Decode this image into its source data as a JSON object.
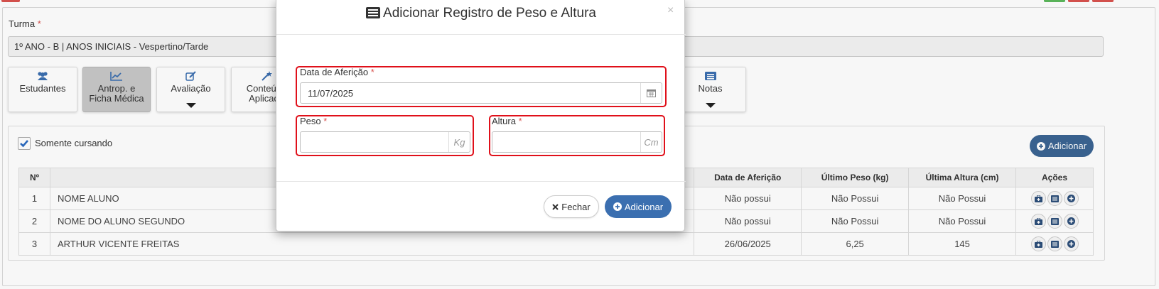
{
  "colors": {
    "accent": "#3b6fb0",
    "header_add": "#3b6593",
    "highlight": "#e0101a",
    "required": "#d9534f"
  },
  "form": {
    "turma_label": "Turma",
    "turma_required": "*",
    "turma_value": "1º ANO - B | ANOS INICIAIS - Vespertino/Tarde"
  },
  "tabs": [
    {
      "label": "Estudantes",
      "icon": "users-icon"
    },
    {
      "label": "Antrop. e Ficha Médica",
      "icon": "chart-line-icon",
      "active": true
    },
    {
      "label": "Avaliação",
      "icon": "edit-icon"
    },
    {
      "label": "Conteúdo Aplicado",
      "icon": "magic-wand-icon"
    },
    {
      "label": "Notas",
      "icon": "list-icon"
    }
  ],
  "list": {
    "only_active_label": "Somente cursando",
    "only_active_checked": true,
    "add_button": "Adicionar",
    "columns": [
      "Nº",
      "",
      "Data de Aferição",
      "Último Peso (kg)",
      "Última Altura (cm)",
      "Ações"
    ],
    "rows": [
      {
        "n": "1",
        "name": "NOME ALUNO",
        "date": "Não possui",
        "weight": "Não Possui",
        "height": "Não Possui"
      },
      {
        "n": "2",
        "name": "NOME DO ALUNO SEGUNDO",
        "date": "Não possui",
        "weight": "Não Possui",
        "height": "Não Possui"
      },
      {
        "n": "3",
        "name": "ARTHUR VICENTE FREITAS",
        "date": "26/06/2025",
        "weight": "6,25",
        "height": "145"
      }
    ]
  },
  "modal": {
    "title": "Adicionar Registro de Peso e Altura",
    "title_icon": "list-icon",
    "close": "×",
    "date_label": "Data de Aferição",
    "date_value": "11/07/2025",
    "date_icon": "calendar-icon",
    "peso_label": "Peso",
    "peso_value": "",
    "peso_unit": "Kg",
    "altura_label": "Altura",
    "altura_value": "",
    "altura_unit": "Cm",
    "required": "*",
    "cancel_label": "Fechar",
    "submit_label": "Adicionar"
  }
}
